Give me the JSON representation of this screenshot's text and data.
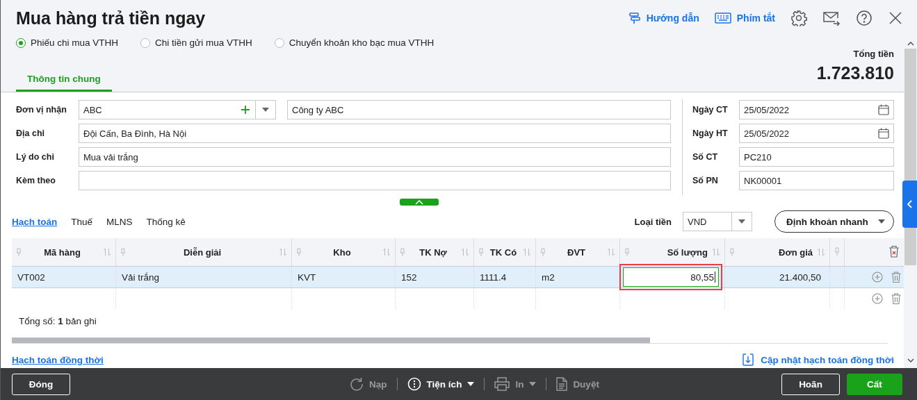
{
  "title": "Mua hàng trả tiền ngay",
  "header_links": [
    {
      "label": "Hướng dẫn",
      "kind": "guide"
    },
    {
      "label": "Phím tắt",
      "kind": "shortcuts"
    }
  ],
  "voucher_types": [
    {
      "label": "Phiếu chi mua VTHH",
      "selected": true
    },
    {
      "label": "Chi tiền gửi mua VTHH",
      "selected": false
    },
    {
      "label": "Chuyển khoản kho bạc mua VTHH",
      "selected": false
    }
  ],
  "tabs": [
    {
      "label": "Thông tin chung",
      "selected": true
    }
  ],
  "total": {
    "label": "Tổng tiền",
    "value": "1.723.810"
  },
  "left_fields": [
    {
      "label": "Đơn vị nhận",
      "kind": "partner",
      "value": "ABC",
      "name": "Công ty ABC"
    },
    {
      "label": "Địa chỉ",
      "kind": "text",
      "value": "Đội Cấn, Ba Đình, Hà Nội"
    },
    {
      "label": "Lý do chi",
      "kind": "text",
      "value": "Mua vải trắng"
    },
    {
      "label": "Kèm theo",
      "kind": "text"
    }
  ],
  "right_fields": [
    {
      "label": "Ngày CT",
      "kind": "date",
      "value": "25/05/2022"
    },
    {
      "label": "Ngày HT",
      "kind": "date",
      "value": "25/05/2022"
    },
    {
      "label": "Số CT",
      "kind": "text",
      "value": "PC210"
    },
    {
      "label": "Số PN",
      "kind": "text",
      "value": "NK00001"
    }
  ],
  "detail_tabs": [
    {
      "label": "Hạch toán",
      "selected": true
    },
    {
      "label": "Thuế",
      "selected": false
    },
    {
      "label": "MLNS",
      "selected": false
    },
    {
      "label": "Thống kê",
      "selected": false
    }
  ],
  "currency": {
    "label": "Loại tiền",
    "value": "VND"
  },
  "quick_entry_button": "Định khoản nhanh",
  "table": {
    "columns": [
      {
        "label": "Mã hàng",
        "kind": "text"
      },
      {
        "label": "Diễn giải",
        "kind": "text"
      },
      {
        "label": "Kho",
        "kind": "text"
      },
      {
        "label": "TK Nợ",
        "kind": "text"
      },
      {
        "label": "TK Có",
        "kind": "text"
      },
      {
        "label": "ĐVT",
        "kind": "text"
      },
      {
        "label": "Số lượng",
        "kind": "number"
      },
      {
        "label": "Đơn giá",
        "kind": "number"
      }
    ],
    "rows": [
      {
        "selected": true,
        "cells": [
          {
            "value": "VT002",
            "editing": false
          },
          {
            "value": "Vải trắng",
            "editing": false
          },
          {
            "value": "KVT",
            "editing": false
          },
          {
            "value": "152",
            "editing": false
          },
          {
            "value": "1111.4",
            "editing": false
          },
          {
            "value": "m2",
            "editing": false
          },
          {
            "value": "80,55",
            "editing": true
          },
          {
            "value": "21.400,50",
            "editing": false
          }
        ]
      }
    ],
    "record_count": "Tổng số: **1** bản ghi"
  },
  "links": {
    "left": "Hạch toán đồng thời",
    "right": "Cập nhật hạch toán đồng thời"
  },
  "footer": {
    "close": "Đóng",
    "tools": [
      {
        "label": "Nạp",
        "kind": "reload",
        "disabled": true,
        "dropdown": false
      },
      {
        "label": "Tiện ích",
        "kind": "utilities",
        "disabled": false,
        "dropdown": true
      },
      {
        "label": "In",
        "kind": "print",
        "disabled": true,
        "dropdown": true
      },
      {
        "label": "Duyệt",
        "kind": "approve",
        "disabled": true,
        "dropdown": false
      }
    ],
    "defer": "Hoãn",
    "save": "Cất"
  }
}
